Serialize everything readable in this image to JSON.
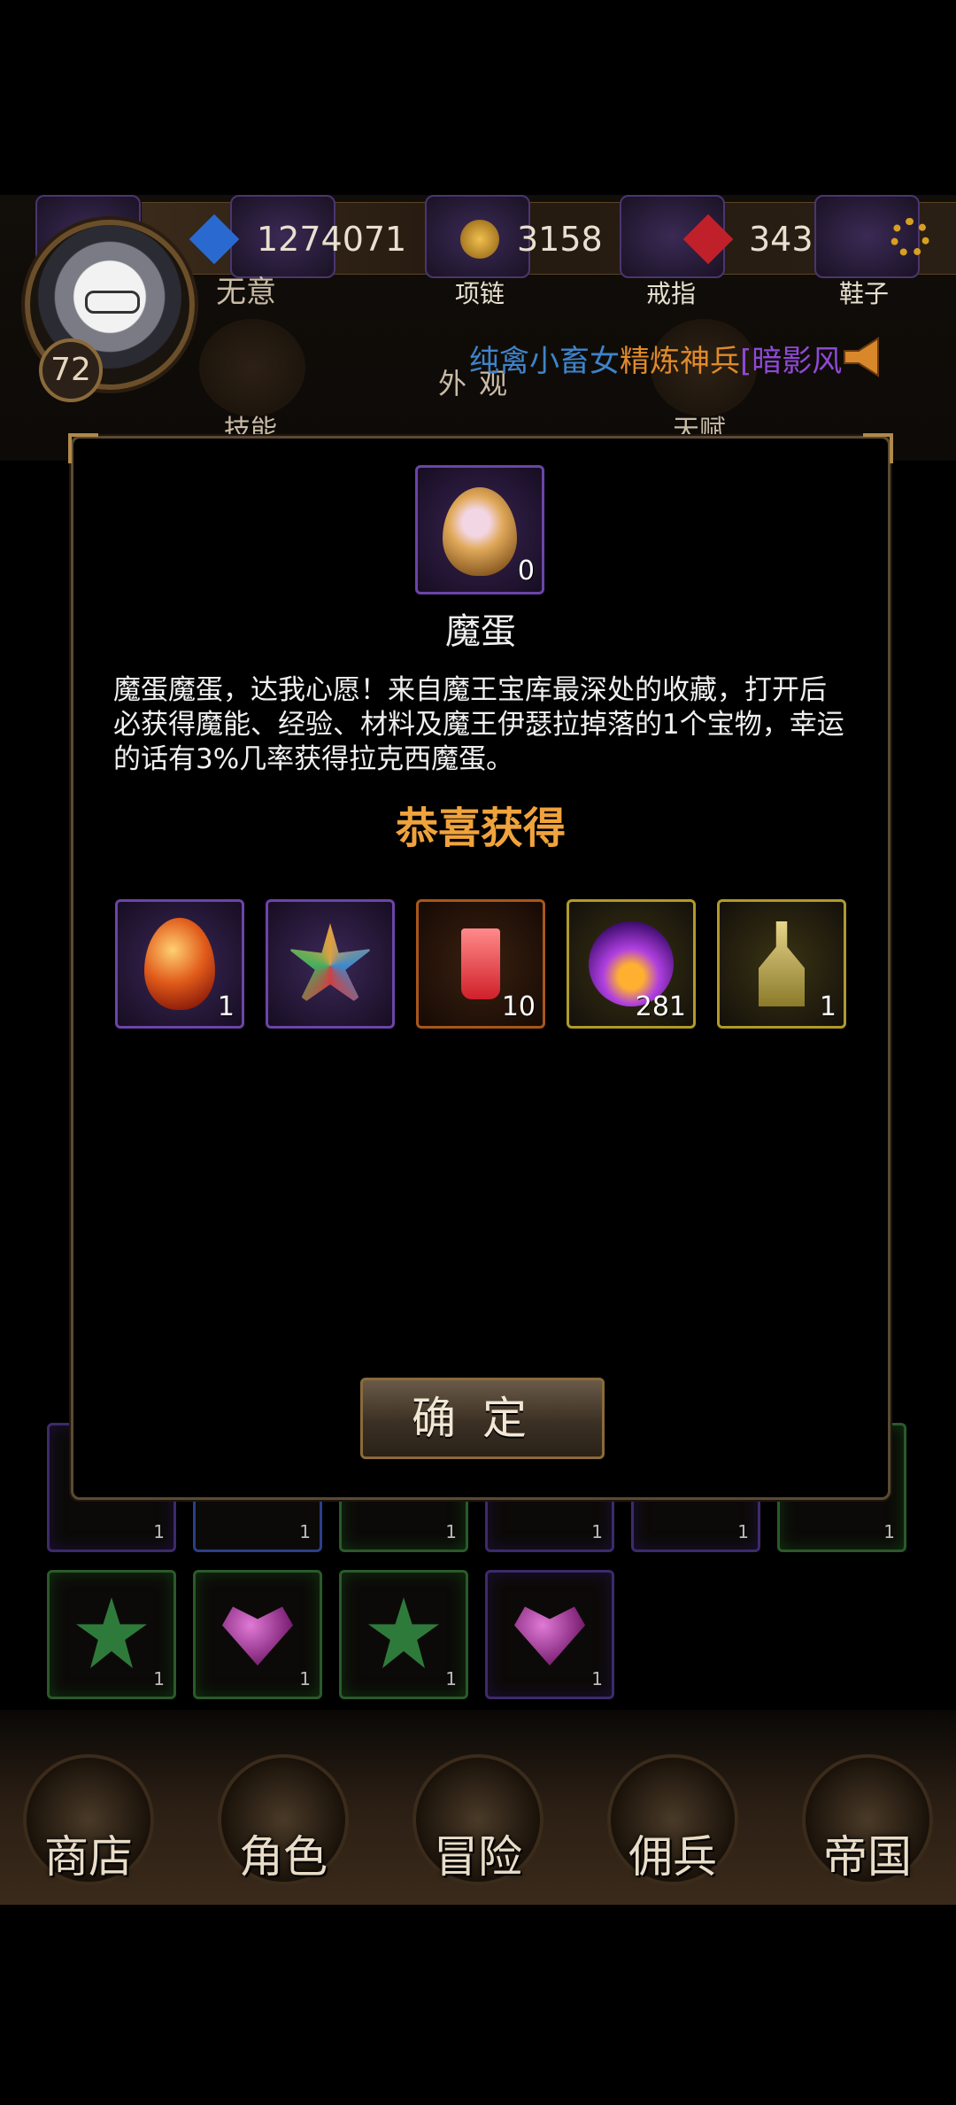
{
  "player": {
    "level": "72",
    "name": "无意",
    "currency_1": "1274071",
    "currency_2": "3158",
    "currency_3": "343"
  },
  "equipment_labels": {
    "necklace": "项链",
    "ring": "戒指",
    "shoes": "鞋子"
  },
  "ticker": {
    "part1": "纯禽小畜女",
    "part2": "精炼神兵",
    "part3": "[暗影风"
  },
  "tabs": {
    "skills": "技能",
    "appearance": "外观",
    "talent": "天赋"
  },
  "grid": {
    "row1": [
      {
        "kind": "purple",
        "count": "1"
      },
      {
        "kind": "blue",
        "count": "1"
      },
      {
        "kind": "green",
        "count": "1"
      },
      {
        "kind": "purple",
        "count": "1"
      },
      {
        "kind": "purple",
        "count": "1"
      },
      {
        "kind": "green",
        "count": "1"
      }
    ],
    "row2": [
      {
        "kind": "star",
        "count": "1"
      },
      {
        "kind": "heart",
        "count": "1"
      },
      {
        "kind": "star",
        "count": "1"
      },
      {
        "kind": "heart",
        "count": "1"
      }
    ]
  },
  "dialog": {
    "item_name": "魔蛋",
    "item_count": "0",
    "description": "魔蛋魔蛋，达我心愿！来自魔王宝库最深处的收藏，打开后必获得魔能、经验、材料及魔王伊瑟拉掉落的1个宝物，幸运的话有3%几率获得拉克西魔蛋。",
    "congrats": "恭喜获得",
    "rewards": [
      {
        "icon": "red-egg-icon",
        "count": "1"
      },
      {
        "icon": "necklace-icon",
        "count": ""
      },
      {
        "icon": "drink-icon",
        "count": "10"
      },
      {
        "icon": "magic-orb-icon",
        "count": "281"
      },
      {
        "icon": "potion-flask-icon",
        "count": "1"
      }
    ],
    "confirm": "确定"
  },
  "nav": {
    "shop": "商店",
    "character": "角色",
    "adventure": "冒险",
    "mercenary": "佣兵",
    "empire": "帝国"
  },
  "colors": {
    "accent_orange": "#f0a33c",
    "frame_purple": "#6c44a8",
    "frame_gold": "#b09a2a",
    "frame_orange": "#a8561a"
  }
}
